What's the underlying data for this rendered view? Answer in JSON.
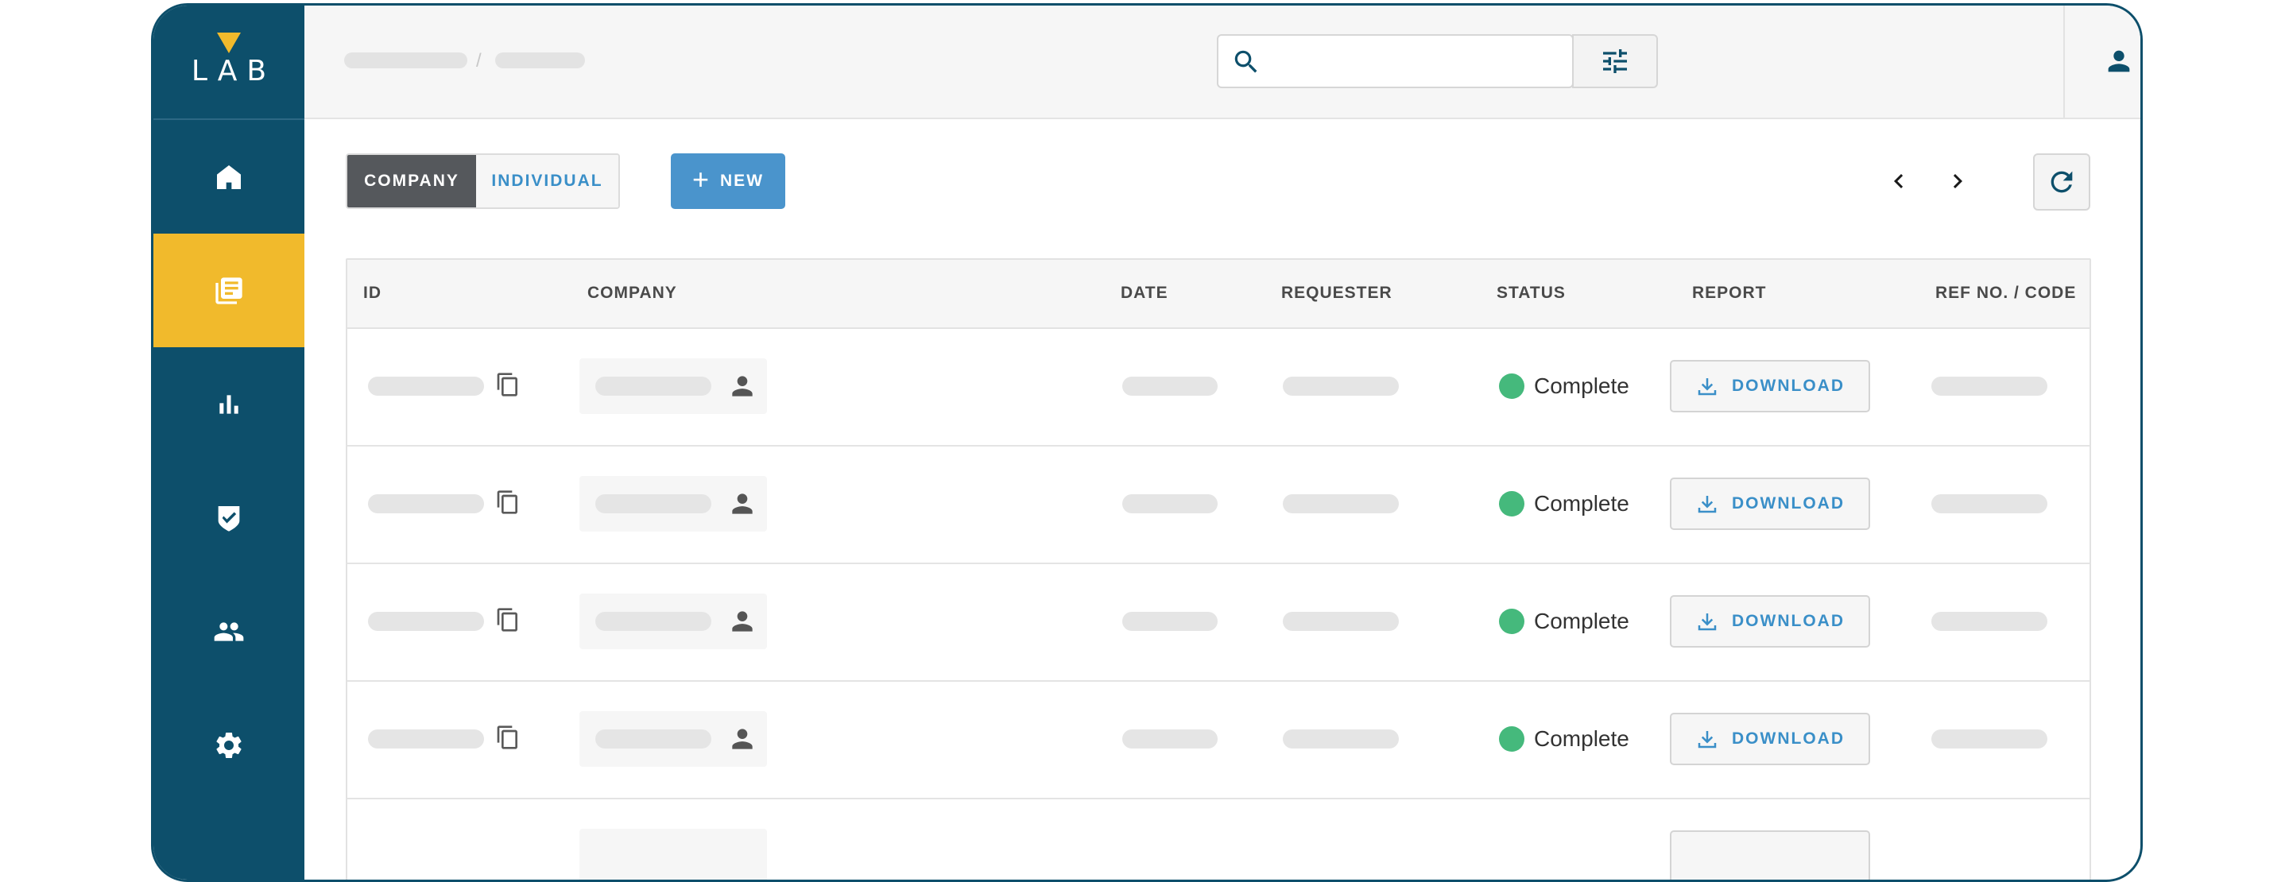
{
  "logo": {
    "text": "LAB"
  },
  "breadcrumb": {
    "separator": "/"
  },
  "toolbar": {
    "segments": [
      "COMPANY",
      "INDIVIDUAL"
    ],
    "active_segment": "COMPANY",
    "new_label": "NEW"
  },
  "table": {
    "headers": [
      "ID",
      "COMPANY",
      "DATE",
      "REQUESTER",
      "STATUS",
      "REPORT",
      "REF NO. / CODE"
    ],
    "rows": [
      {
        "status": "Complete",
        "report": "DOWNLOAD"
      },
      {
        "status": "Complete",
        "report": "DOWNLOAD"
      },
      {
        "status": "Complete",
        "report": "DOWNLOAD"
      },
      {
        "status": "Complete",
        "report": "DOWNLOAD"
      }
    ]
  },
  "colors": {
    "sidebar": "#0d4f6b",
    "accent": "#f1ba2c",
    "primary": "#4a94cc",
    "status_complete": "#45b97c"
  },
  "icons": {
    "sidebar": [
      "home-icon",
      "documents-icon",
      "chart-icon",
      "shield-check-icon",
      "people-icon",
      "gear-icon"
    ],
    "header": [
      "search-icon",
      "filter-icon",
      "user-icon",
      "bell-icon"
    ]
  }
}
